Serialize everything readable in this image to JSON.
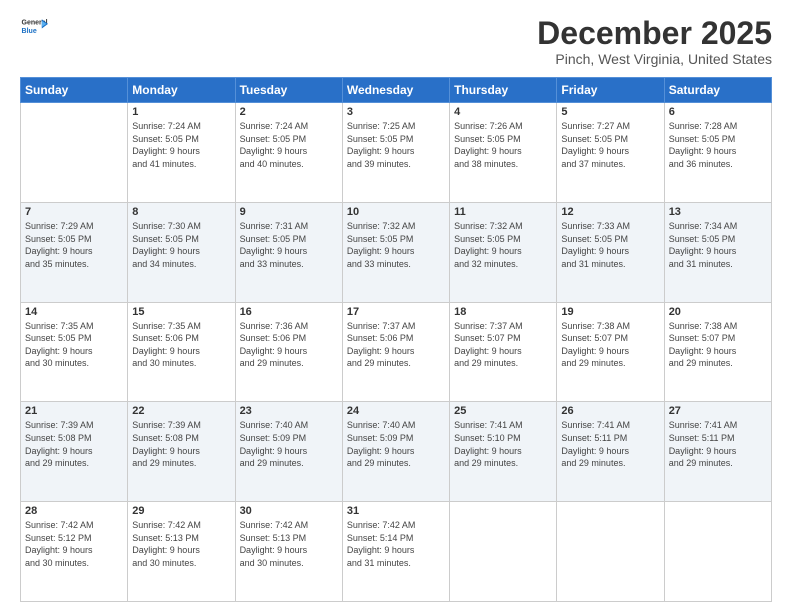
{
  "logo": {
    "line1": "General",
    "line2": "Blue"
  },
  "title": "December 2025",
  "location": "Pinch, West Virginia, United States",
  "days_header": [
    "Sunday",
    "Monday",
    "Tuesday",
    "Wednesday",
    "Thursday",
    "Friday",
    "Saturday"
  ],
  "weeks": [
    [
      {
        "day": "",
        "info": ""
      },
      {
        "day": "1",
        "info": "Sunrise: 7:24 AM\nSunset: 5:05 PM\nDaylight: 9 hours\nand 41 minutes."
      },
      {
        "day": "2",
        "info": "Sunrise: 7:24 AM\nSunset: 5:05 PM\nDaylight: 9 hours\nand 40 minutes."
      },
      {
        "day": "3",
        "info": "Sunrise: 7:25 AM\nSunset: 5:05 PM\nDaylight: 9 hours\nand 39 minutes."
      },
      {
        "day": "4",
        "info": "Sunrise: 7:26 AM\nSunset: 5:05 PM\nDaylight: 9 hours\nand 38 minutes."
      },
      {
        "day": "5",
        "info": "Sunrise: 7:27 AM\nSunset: 5:05 PM\nDaylight: 9 hours\nand 37 minutes."
      },
      {
        "day": "6",
        "info": "Sunrise: 7:28 AM\nSunset: 5:05 PM\nDaylight: 9 hours\nand 36 minutes."
      }
    ],
    [
      {
        "day": "7",
        "info": "Sunrise: 7:29 AM\nSunset: 5:05 PM\nDaylight: 9 hours\nand 35 minutes."
      },
      {
        "day": "8",
        "info": "Sunrise: 7:30 AM\nSunset: 5:05 PM\nDaylight: 9 hours\nand 34 minutes."
      },
      {
        "day": "9",
        "info": "Sunrise: 7:31 AM\nSunset: 5:05 PM\nDaylight: 9 hours\nand 33 minutes."
      },
      {
        "day": "10",
        "info": "Sunrise: 7:32 AM\nSunset: 5:05 PM\nDaylight: 9 hours\nand 33 minutes."
      },
      {
        "day": "11",
        "info": "Sunrise: 7:32 AM\nSunset: 5:05 PM\nDaylight: 9 hours\nand 32 minutes."
      },
      {
        "day": "12",
        "info": "Sunrise: 7:33 AM\nSunset: 5:05 PM\nDaylight: 9 hours\nand 31 minutes."
      },
      {
        "day": "13",
        "info": "Sunrise: 7:34 AM\nSunset: 5:05 PM\nDaylight: 9 hours\nand 31 minutes."
      }
    ],
    [
      {
        "day": "14",
        "info": "Sunrise: 7:35 AM\nSunset: 5:05 PM\nDaylight: 9 hours\nand 30 minutes."
      },
      {
        "day": "15",
        "info": "Sunrise: 7:35 AM\nSunset: 5:06 PM\nDaylight: 9 hours\nand 30 minutes."
      },
      {
        "day": "16",
        "info": "Sunrise: 7:36 AM\nSunset: 5:06 PM\nDaylight: 9 hours\nand 29 minutes."
      },
      {
        "day": "17",
        "info": "Sunrise: 7:37 AM\nSunset: 5:06 PM\nDaylight: 9 hours\nand 29 minutes."
      },
      {
        "day": "18",
        "info": "Sunrise: 7:37 AM\nSunset: 5:07 PM\nDaylight: 9 hours\nand 29 minutes."
      },
      {
        "day": "19",
        "info": "Sunrise: 7:38 AM\nSunset: 5:07 PM\nDaylight: 9 hours\nand 29 minutes."
      },
      {
        "day": "20",
        "info": "Sunrise: 7:38 AM\nSunset: 5:07 PM\nDaylight: 9 hours\nand 29 minutes."
      }
    ],
    [
      {
        "day": "21",
        "info": "Sunrise: 7:39 AM\nSunset: 5:08 PM\nDaylight: 9 hours\nand 29 minutes."
      },
      {
        "day": "22",
        "info": "Sunrise: 7:39 AM\nSunset: 5:08 PM\nDaylight: 9 hours\nand 29 minutes."
      },
      {
        "day": "23",
        "info": "Sunrise: 7:40 AM\nSunset: 5:09 PM\nDaylight: 9 hours\nand 29 minutes."
      },
      {
        "day": "24",
        "info": "Sunrise: 7:40 AM\nSunset: 5:09 PM\nDaylight: 9 hours\nand 29 minutes."
      },
      {
        "day": "25",
        "info": "Sunrise: 7:41 AM\nSunset: 5:10 PM\nDaylight: 9 hours\nand 29 minutes."
      },
      {
        "day": "26",
        "info": "Sunrise: 7:41 AM\nSunset: 5:11 PM\nDaylight: 9 hours\nand 29 minutes."
      },
      {
        "day": "27",
        "info": "Sunrise: 7:41 AM\nSunset: 5:11 PM\nDaylight: 9 hours\nand 29 minutes."
      }
    ],
    [
      {
        "day": "28",
        "info": "Sunrise: 7:42 AM\nSunset: 5:12 PM\nDaylight: 9 hours\nand 30 minutes."
      },
      {
        "day": "29",
        "info": "Sunrise: 7:42 AM\nSunset: 5:13 PM\nDaylight: 9 hours\nand 30 minutes."
      },
      {
        "day": "30",
        "info": "Sunrise: 7:42 AM\nSunset: 5:13 PM\nDaylight: 9 hours\nand 30 minutes."
      },
      {
        "day": "31",
        "info": "Sunrise: 7:42 AM\nSunset: 5:14 PM\nDaylight: 9 hours\nand 31 minutes."
      },
      {
        "day": "",
        "info": ""
      },
      {
        "day": "",
        "info": ""
      },
      {
        "day": "",
        "info": ""
      }
    ]
  ]
}
